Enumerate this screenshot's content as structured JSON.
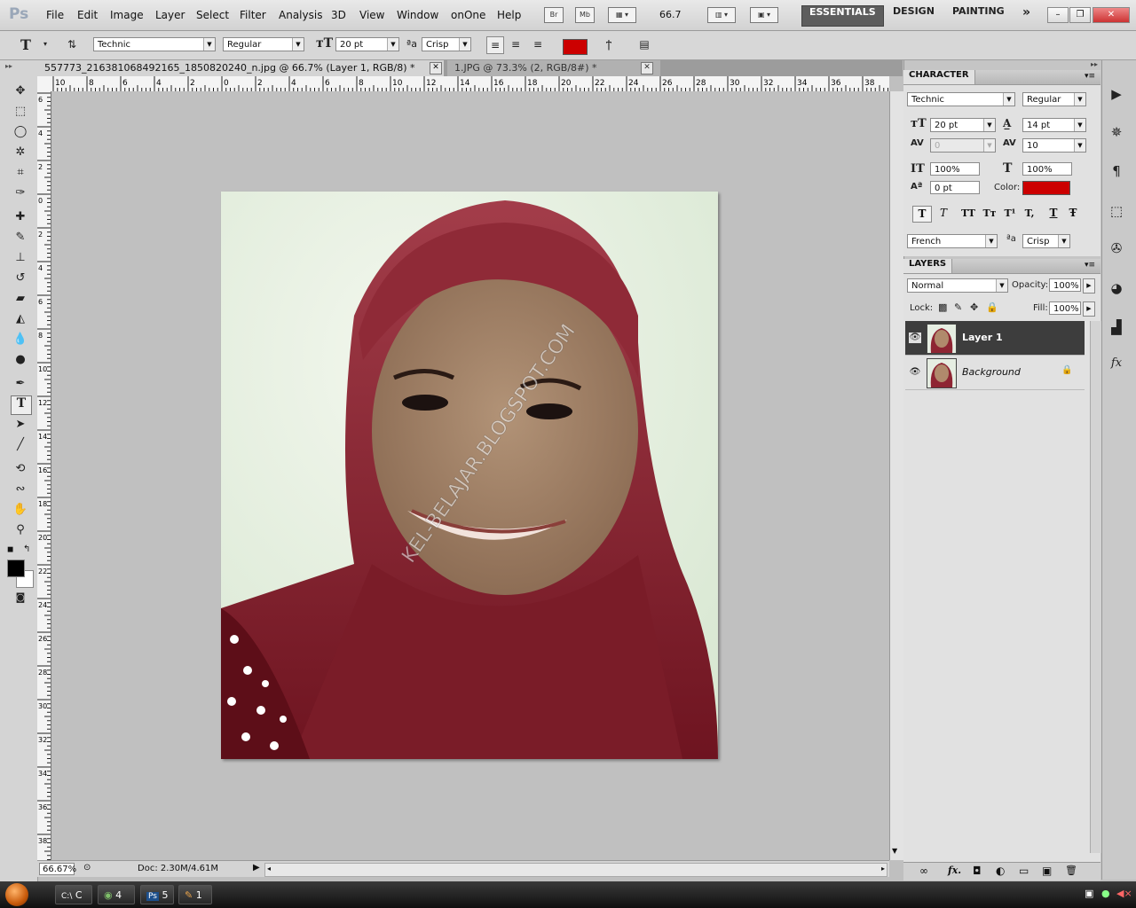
{
  "app": {
    "logo": "Ps"
  },
  "menu": [
    "File",
    "Edit",
    "Image",
    "Layer",
    "Select",
    "Filter",
    "Analysis",
    "3D",
    "View",
    "Window",
    "onOne",
    "Help"
  ],
  "menubar": {
    "bridge_icon": "Br",
    "minibridge_icon": "Mb",
    "zoom": "66.7",
    "workspaces": [
      "ESSENTIALS",
      "DESIGN",
      "PAINTING"
    ],
    "more": "»",
    "win_controls": [
      "–",
      "❐",
      "✕"
    ]
  },
  "options": {
    "tool_glyph": "T",
    "font_family": "Technic",
    "font_style": "Regular",
    "font_size": "20 pt",
    "aa_glyph": "ªa",
    "antialias": "Crisp",
    "text_color": "#cc0000"
  },
  "tabs": [
    {
      "title": "557773_216381068492165_1850820240_n.jpg @ 66.7% (Layer 1, RGB/8) *",
      "close": "✕"
    },
    {
      "title": "1.JPG @ 73.3% (2, RGB/8#) *",
      "close": "✕"
    }
  ],
  "ruler_h": [
    "10",
    "8",
    "6",
    "4",
    "2",
    "0",
    "2",
    "4",
    "6",
    "8",
    "10",
    "12",
    "14",
    "16",
    "18",
    "20",
    "22",
    "24",
    "26",
    "28",
    "30",
    "32",
    "34",
    "36",
    "38"
  ],
  "ruler_v": [
    "6",
    "4",
    "2",
    "0",
    "2",
    "4",
    "6",
    "8",
    "10",
    "12",
    "14",
    "16",
    "18",
    "20",
    "22",
    "24",
    "26",
    "28",
    "30",
    "32",
    "34",
    "36",
    "38"
  ],
  "watermark": "KEL-BELAJAR.BLOGSPOT.COM",
  "status": {
    "zoom": "66.67%",
    "doc": "Doc: 2.30M/4.61M",
    "arrow": "▶"
  },
  "character": {
    "tab": "CHARACTER",
    "font_family": "Technic",
    "font_style": "Regular",
    "size": "20 pt",
    "leading": "14 pt",
    "kerning": "0",
    "tracking": "10",
    "vscale": "100%",
    "hscale": "100%",
    "baseline": "0 pt",
    "color_label": "Color:",
    "color": "#cc0000",
    "style_buttons": [
      "T",
      "T",
      "TT",
      "Tт",
      "T¹",
      "T,",
      "T",
      "Ŧ"
    ],
    "language": "French",
    "aa_glyph": "ªa",
    "antialias": "Crisp"
  },
  "layers": {
    "tab": "LAYERS",
    "blend": "Normal",
    "opacity_label": "Opacity:",
    "opacity": "100%",
    "lock_label": "Lock:",
    "fill_label": "Fill:",
    "fill": "100%",
    "items": [
      {
        "name": "Layer 1",
        "selected": true
      },
      {
        "name": "Background",
        "selected": false,
        "locked": true
      }
    ],
    "footer_icons": [
      "link-icon",
      "fx-icon",
      "mask-icon",
      "adjustment-icon",
      "group-icon",
      "new-layer-icon",
      "trash-icon"
    ],
    "footer_glyphs": [
      "∞",
      "fx.",
      "◘",
      "◐",
      "▭",
      "▣",
      "🗑"
    ]
  },
  "taskbar": [
    {
      "label": "C",
      "icon": "cmd-icon",
      "glyph": "C:\\"
    },
    {
      "label": "4",
      "icon": "browser-icon",
      "glyph": "◉"
    },
    {
      "label": "5",
      "icon": "photoshop-icon",
      "glyph": "Ps"
    },
    {
      "label": "1",
      "icon": "paint-icon",
      "glyph": "✎"
    }
  ]
}
